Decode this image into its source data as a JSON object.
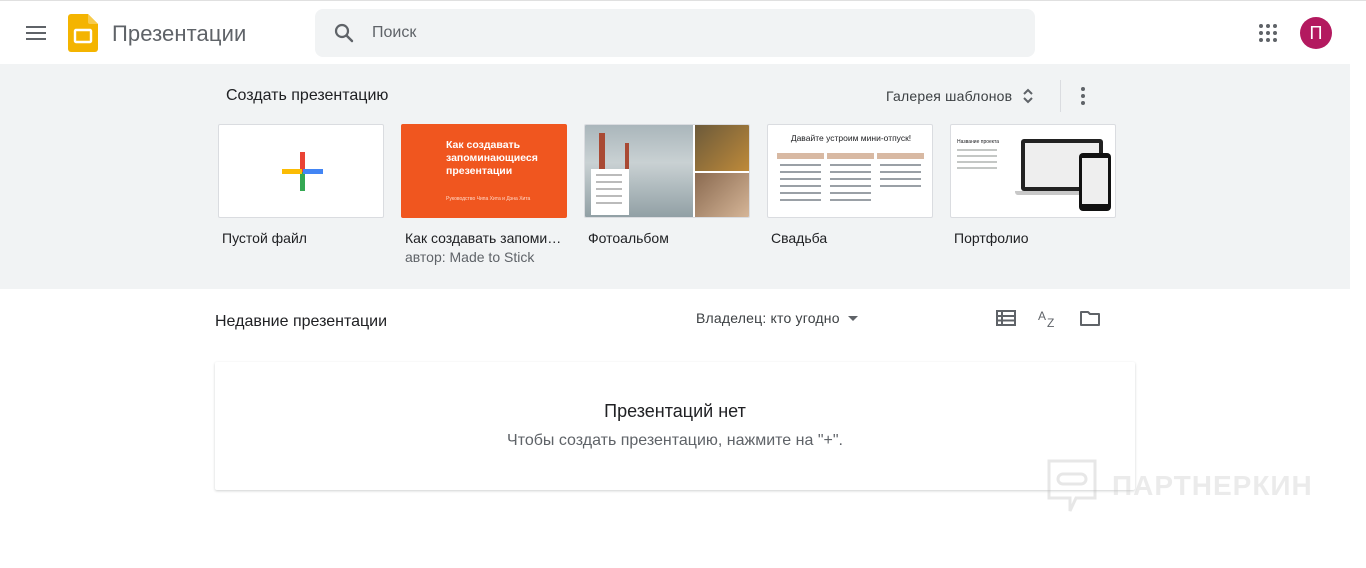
{
  "header": {
    "app_title": "Презентации",
    "search_placeholder": "Поиск",
    "avatar_letter": "П",
    "menu_icon": "hamburger-menu-icon",
    "apps_icon": "apps-grid-icon",
    "brand_color": "#f4b400",
    "avatar_color": "#b3195f"
  },
  "gallery": {
    "title": "Создать презентацию",
    "toggle_label": "Галерея шаблонов",
    "templates": [
      {
        "name": "Пустой файл",
        "author": ""
      },
      {
        "name": "Как создавать запоминающиеся презентации",
        "author": "автор: Made to Stick",
        "thumb_title": "Как создавать запоминающиеся презентации",
        "thumb_subtitle": "Руководство Чипа Хита и Дэна Хита"
      },
      {
        "name": "Фотоальбом",
        "author": ""
      },
      {
        "name": "Свадьба",
        "author": "",
        "thumb_title": "Давайте устроим мини-отпуск!"
      },
      {
        "name": "Портфолио",
        "author": "",
        "thumb_title": "Название проекта"
      }
    ]
  },
  "recent": {
    "title": "Недавние презентации",
    "owner_filter": "Владелец: кто угодно",
    "empty_title": "Презентаций нет",
    "empty_subtitle": "Чтобы создать презентацию, нажмите на \"+\"."
  },
  "watermark": {
    "text": "ПАРТНЕРКИН"
  }
}
